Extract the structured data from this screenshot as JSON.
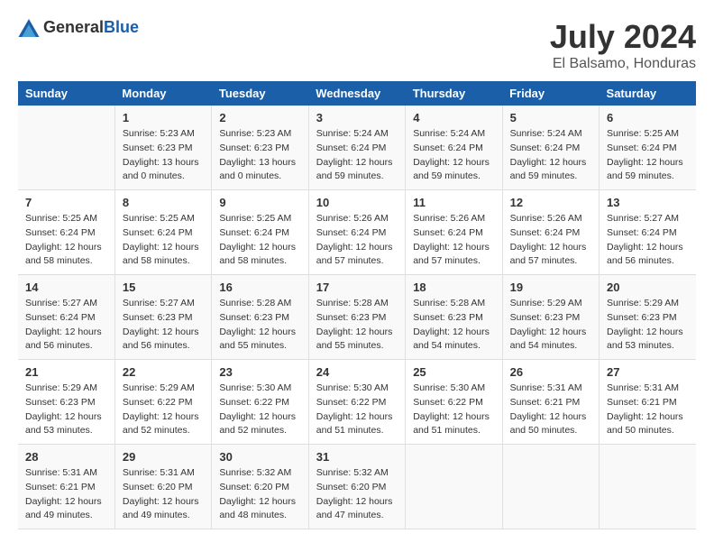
{
  "header": {
    "logo_general": "General",
    "logo_blue": "Blue",
    "month_year": "July 2024",
    "location": "El Balsamo, Honduras"
  },
  "days_of_week": [
    "Sunday",
    "Monday",
    "Tuesday",
    "Wednesday",
    "Thursday",
    "Friday",
    "Saturday"
  ],
  "weeks": [
    [
      {
        "day": "",
        "sunrise": "",
        "sunset": "",
        "daylight": ""
      },
      {
        "day": "1",
        "sunrise": "Sunrise: 5:23 AM",
        "sunset": "Sunset: 6:23 PM",
        "daylight": "Daylight: 13 hours and 0 minutes."
      },
      {
        "day": "2",
        "sunrise": "Sunrise: 5:23 AM",
        "sunset": "Sunset: 6:23 PM",
        "daylight": "Daylight: 13 hours and 0 minutes."
      },
      {
        "day": "3",
        "sunrise": "Sunrise: 5:24 AM",
        "sunset": "Sunset: 6:24 PM",
        "daylight": "Daylight: 12 hours and 59 minutes."
      },
      {
        "day": "4",
        "sunrise": "Sunrise: 5:24 AM",
        "sunset": "Sunset: 6:24 PM",
        "daylight": "Daylight: 12 hours and 59 minutes."
      },
      {
        "day": "5",
        "sunrise": "Sunrise: 5:24 AM",
        "sunset": "Sunset: 6:24 PM",
        "daylight": "Daylight: 12 hours and 59 minutes."
      },
      {
        "day": "6",
        "sunrise": "Sunrise: 5:25 AM",
        "sunset": "Sunset: 6:24 PM",
        "daylight": "Daylight: 12 hours and 59 minutes."
      }
    ],
    [
      {
        "day": "7",
        "sunrise": "Sunrise: 5:25 AM",
        "sunset": "Sunset: 6:24 PM",
        "daylight": "Daylight: 12 hours and 58 minutes."
      },
      {
        "day": "8",
        "sunrise": "Sunrise: 5:25 AM",
        "sunset": "Sunset: 6:24 PM",
        "daylight": "Daylight: 12 hours and 58 minutes."
      },
      {
        "day": "9",
        "sunrise": "Sunrise: 5:25 AM",
        "sunset": "Sunset: 6:24 PM",
        "daylight": "Daylight: 12 hours and 58 minutes."
      },
      {
        "day": "10",
        "sunrise": "Sunrise: 5:26 AM",
        "sunset": "Sunset: 6:24 PM",
        "daylight": "Daylight: 12 hours and 57 minutes."
      },
      {
        "day": "11",
        "sunrise": "Sunrise: 5:26 AM",
        "sunset": "Sunset: 6:24 PM",
        "daylight": "Daylight: 12 hours and 57 minutes."
      },
      {
        "day": "12",
        "sunrise": "Sunrise: 5:26 AM",
        "sunset": "Sunset: 6:24 PM",
        "daylight": "Daylight: 12 hours and 57 minutes."
      },
      {
        "day": "13",
        "sunrise": "Sunrise: 5:27 AM",
        "sunset": "Sunset: 6:24 PM",
        "daylight": "Daylight: 12 hours and 56 minutes."
      }
    ],
    [
      {
        "day": "14",
        "sunrise": "Sunrise: 5:27 AM",
        "sunset": "Sunset: 6:24 PM",
        "daylight": "Daylight: 12 hours and 56 minutes."
      },
      {
        "day": "15",
        "sunrise": "Sunrise: 5:27 AM",
        "sunset": "Sunset: 6:23 PM",
        "daylight": "Daylight: 12 hours and 56 minutes."
      },
      {
        "day": "16",
        "sunrise": "Sunrise: 5:28 AM",
        "sunset": "Sunset: 6:23 PM",
        "daylight": "Daylight: 12 hours and 55 minutes."
      },
      {
        "day": "17",
        "sunrise": "Sunrise: 5:28 AM",
        "sunset": "Sunset: 6:23 PM",
        "daylight": "Daylight: 12 hours and 55 minutes."
      },
      {
        "day": "18",
        "sunrise": "Sunrise: 5:28 AM",
        "sunset": "Sunset: 6:23 PM",
        "daylight": "Daylight: 12 hours and 54 minutes."
      },
      {
        "day": "19",
        "sunrise": "Sunrise: 5:29 AM",
        "sunset": "Sunset: 6:23 PM",
        "daylight": "Daylight: 12 hours and 54 minutes."
      },
      {
        "day": "20",
        "sunrise": "Sunrise: 5:29 AM",
        "sunset": "Sunset: 6:23 PM",
        "daylight": "Daylight: 12 hours and 53 minutes."
      }
    ],
    [
      {
        "day": "21",
        "sunrise": "Sunrise: 5:29 AM",
        "sunset": "Sunset: 6:23 PM",
        "daylight": "Daylight: 12 hours and 53 minutes."
      },
      {
        "day": "22",
        "sunrise": "Sunrise: 5:29 AM",
        "sunset": "Sunset: 6:22 PM",
        "daylight": "Daylight: 12 hours and 52 minutes."
      },
      {
        "day": "23",
        "sunrise": "Sunrise: 5:30 AM",
        "sunset": "Sunset: 6:22 PM",
        "daylight": "Daylight: 12 hours and 52 minutes."
      },
      {
        "day": "24",
        "sunrise": "Sunrise: 5:30 AM",
        "sunset": "Sunset: 6:22 PM",
        "daylight": "Daylight: 12 hours and 51 minutes."
      },
      {
        "day": "25",
        "sunrise": "Sunrise: 5:30 AM",
        "sunset": "Sunset: 6:22 PM",
        "daylight": "Daylight: 12 hours and 51 minutes."
      },
      {
        "day": "26",
        "sunrise": "Sunrise: 5:31 AM",
        "sunset": "Sunset: 6:21 PM",
        "daylight": "Daylight: 12 hours and 50 minutes."
      },
      {
        "day": "27",
        "sunrise": "Sunrise: 5:31 AM",
        "sunset": "Sunset: 6:21 PM",
        "daylight": "Daylight: 12 hours and 50 minutes."
      }
    ],
    [
      {
        "day": "28",
        "sunrise": "Sunrise: 5:31 AM",
        "sunset": "Sunset: 6:21 PM",
        "daylight": "Daylight: 12 hours and 49 minutes."
      },
      {
        "day": "29",
        "sunrise": "Sunrise: 5:31 AM",
        "sunset": "Sunset: 6:20 PM",
        "daylight": "Daylight: 12 hours and 49 minutes."
      },
      {
        "day": "30",
        "sunrise": "Sunrise: 5:32 AM",
        "sunset": "Sunset: 6:20 PM",
        "daylight": "Daylight: 12 hours and 48 minutes."
      },
      {
        "day": "31",
        "sunrise": "Sunrise: 5:32 AM",
        "sunset": "Sunset: 6:20 PM",
        "daylight": "Daylight: 12 hours and 47 minutes."
      },
      {
        "day": "",
        "sunrise": "",
        "sunset": "",
        "daylight": ""
      },
      {
        "day": "",
        "sunrise": "",
        "sunset": "",
        "daylight": ""
      },
      {
        "day": "",
        "sunrise": "",
        "sunset": "",
        "daylight": ""
      }
    ]
  ]
}
